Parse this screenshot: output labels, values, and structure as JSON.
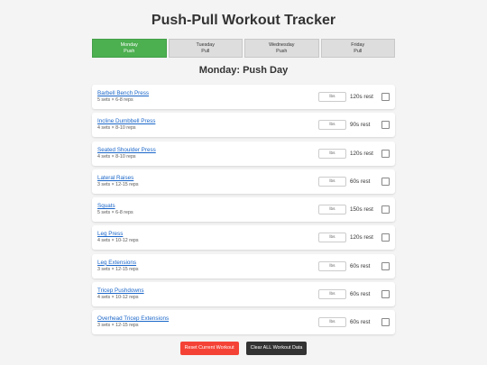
{
  "header": {
    "title": "Push-Pull Workout Tracker"
  },
  "tabs": [
    {
      "day": "Monday",
      "type": "Push",
      "active": true
    },
    {
      "day": "Tuesday",
      "type": "Pull",
      "active": false
    },
    {
      "day": "Wednesday",
      "type": "Push",
      "active": false
    },
    {
      "day": "Friday",
      "type": "Pull",
      "active": false
    }
  ],
  "day_title": "Monday: Push Day",
  "weight_placeholder": "lbs",
  "exercises": [
    {
      "name": "Barbell Bench Press",
      "sets": "5 sets × 6-8 reps",
      "rest": "120s rest"
    },
    {
      "name": "Incline Dumbbell Press",
      "sets": "4 sets × 8-10 reps",
      "rest": "90s rest"
    },
    {
      "name": "Seated Shoulder Press",
      "sets": "4 sets × 8-10 reps",
      "rest": "120s rest"
    },
    {
      "name": "Lateral Raises",
      "sets": "3 sets × 12-15 reps",
      "rest": "60s rest"
    },
    {
      "name": "Squats",
      "sets": "5 sets × 6-8 reps",
      "rest": "150s rest"
    },
    {
      "name": "Leg Press",
      "sets": "4 sets × 10-12 reps",
      "rest": "120s rest"
    },
    {
      "name": "Leg Extensions",
      "sets": "3 sets × 12-15 reps",
      "rest": "60s rest"
    },
    {
      "name": "Tricep Pushdowns",
      "sets": "4 sets × 10-12 reps",
      "rest": "60s rest"
    },
    {
      "name": "Overhead Tricep Extensions",
      "sets": "3 sets × 12-15 reps",
      "rest": "60s rest"
    }
  ],
  "actions": {
    "reset_label": "Reset Current Workout",
    "clear_label": "Clear ALL Workout Data"
  },
  "colors": {
    "active_tab": "#4caf50",
    "reset": "#f44336",
    "clear": "#333333",
    "link": "#1a66c9"
  }
}
